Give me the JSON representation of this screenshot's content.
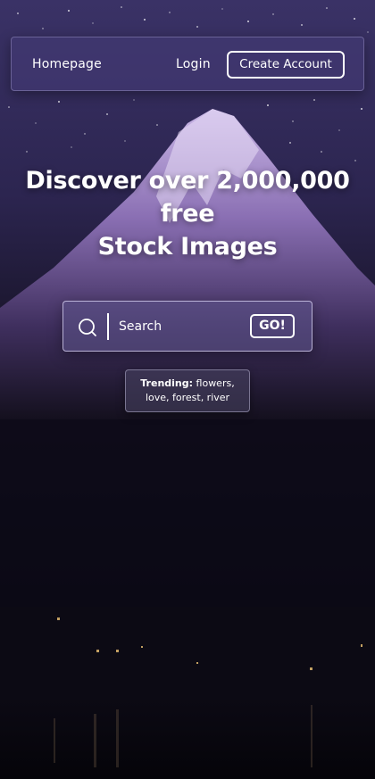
{
  "nav": {
    "home_label": "Homepage",
    "login_label": "Login",
    "create_account_label": "Create Account"
  },
  "hero": {
    "line1": "Discover over 2,000,000 free",
    "line2": "Stock Images"
  },
  "search": {
    "placeholder": "Search",
    "go_label": "GO!",
    "icon": "search-icon"
  },
  "trending": {
    "label": "Trending:",
    "line1": "flowers,",
    "line2": "love, forest, river"
  },
  "colors": {
    "sky_top": "#2c2550",
    "mountain": "#8a78b8",
    "night": "#0a0814"
  }
}
